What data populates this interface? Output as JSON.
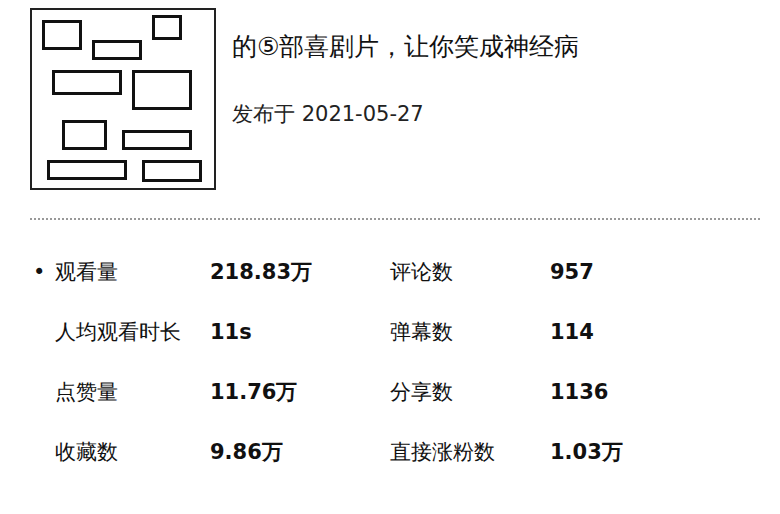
{
  "video": {
    "title": "的⑤部喜剧片，让你笑成神经病",
    "published": "发布于 2021-05-27"
  },
  "bullet": "•",
  "stats": [
    [
      {
        "label": "观看量",
        "value": "218.83万"
      },
      {
        "label": "评论数",
        "value": "957"
      }
    ],
    [
      {
        "label": "人均观看时长",
        "value": "11s"
      },
      {
        "label": "弹幕数",
        "value": "114"
      }
    ],
    [
      {
        "label": "点赞量",
        "value": "11.76万"
      },
      {
        "label": "分享数",
        "value": "1136"
      }
    ],
    [
      {
        "label": "收藏数",
        "value": "9.86万"
      },
      {
        "label": "直接涨粉数",
        "value": "1.03万"
      }
    ]
  ]
}
